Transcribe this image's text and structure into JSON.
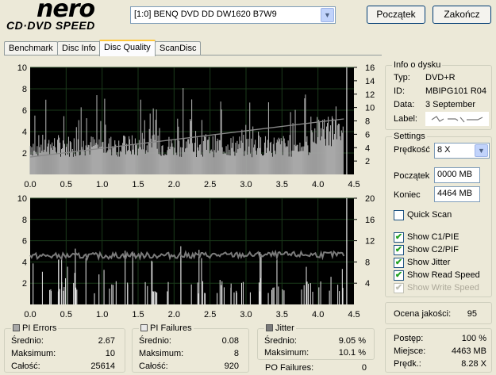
{
  "app": {
    "logo_top": "nero",
    "logo_bottom": "CD·DVD SPEED"
  },
  "toolbar": {
    "drive": "[1:0]  BENQ DVD DD DW1620 B7W9",
    "start_label": "Początek",
    "exit_label": "Zakończ"
  },
  "tabs": [
    {
      "label": "Benchmark"
    },
    {
      "label": "Disc Info"
    },
    {
      "label": "Disc Quality"
    },
    {
      "label": "ScanDisc"
    }
  ],
  "disc_info": {
    "title": "Info o dysku",
    "type_label": "Typ:",
    "type_value": "DVD+R",
    "id_label": "ID:",
    "id_value": "MBIPG101 R04",
    "date_label": "Data:",
    "date_value": "3 September",
    "label_label": "Label:"
  },
  "settings": {
    "title": "Settings",
    "speed_label": "Prędkość",
    "speed_value": "8 X",
    "start_label": "Początek",
    "start_value": "0000 MB",
    "end_label": "Koniec",
    "end_value": "4464 MB",
    "checks": [
      {
        "label": "Quick Scan",
        "checked": false,
        "disabled": false
      },
      {
        "label": "Show C1/PIE",
        "checked": true,
        "disabled": false
      },
      {
        "label": "Show C2/PIF",
        "checked": true,
        "disabled": false
      },
      {
        "label": "Show Jitter",
        "checked": true,
        "disabled": false
      },
      {
        "label": "Show Read Speed",
        "checked": true,
        "disabled": false
      },
      {
        "label": "Show Write Speed",
        "checked": true,
        "disabled": true
      }
    ]
  },
  "quality": {
    "label": "Ocena jakości:",
    "value": "95"
  },
  "progress": {
    "progress_label": "Postęp:",
    "progress_value": "100 %",
    "location_label": "Miejsce:",
    "location_value": "4463 MB",
    "speed_label": "Prędk.:",
    "speed_value": "8.28 X"
  },
  "stats": {
    "pi_errors": {
      "title": "PI Errors",
      "color": "#a8a8a8",
      "avg_label": "Średnio:",
      "avg": "2.67",
      "max_label": "Maksimum:",
      "max": "10",
      "total_label": "Całość:",
      "total": "25614"
    },
    "pi_failures": {
      "title": "PI Failures",
      "color": "#e8e8e8",
      "avg_label": "Średnio:",
      "avg": "0.08",
      "max_label": "Maksimum:",
      "max": "8",
      "total_label": "Całość:",
      "total": "920"
    },
    "jitter": {
      "title": "Jitter",
      "color": "#7a7a7a",
      "avg_label": "Średnio:",
      "avg": "9.05 %",
      "max_label": "Maksimum:",
      "max": "10.1 %",
      "po_label": "PO Failures:",
      "po": "0"
    }
  },
  "chart_data": [
    {
      "type": "bar",
      "title": "",
      "x_ticks": [
        "0.0",
        "0.5",
        "1.0",
        "1.5",
        "2.0",
        "2.5",
        "3.0",
        "3.5",
        "4.0",
        "4.5"
      ],
      "xlim": [
        0,
        4.5
      ],
      "y_left_ticks": [
        "2",
        "4",
        "6",
        "8",
        "10"
      ],
      "ylim_left": [
        0,
        10
      ],
      "y_right_ticks": [
        "2",
        "4",
        "6",
        "8",
        "10",
        "12",
        "14",
        "16"
      ],
      "ylim_right": [
        0,
        16
      ],
      "series": [
        {
          "name": "PI Errors",
          "color": "#a8a8a8",
          "baseline": 2.67,
          "max": 10,
          "max_at": 4.4
        },
        {
          "name": "Read Speed",
          "color": "#888888",
          "start": 2.6,
          "end": 8.3
        }
      ]
    },
    {
      "type": "bar",
      "title": "",
      "x_ticks": [
        "0.0",
        "0.5",
        "1.0",
        "1.5",
        "2.0",
        "2.5",
        "3.0",
        "3.5",
        "4.0",
        "4.5"
      ],
      "xlim": [
        0,
        4.5
      ],
      "y_left_ticks": [
        "2",
        "4",
        "6",
        "8",
        "10"
      ],
      "ylim_left": [
        0,
        10
      ],
      "y_right_ticks": [
        "4",
        "8",
        "12",
        "16",
        "20"
      ],
      "ylim_right": [
        0,
        20
      ],
      "series": [
        {
          "name": "PI Failures",
          "color": "#e8e8e8",
          "max": 8,
          "max_at": 4.4
        },
        {
          "name": "Jitter",
          "color": "#7a7a7a",
          "avg": 9.05,
          "max": 10.1
        }
      ]
    }
  ]
}
